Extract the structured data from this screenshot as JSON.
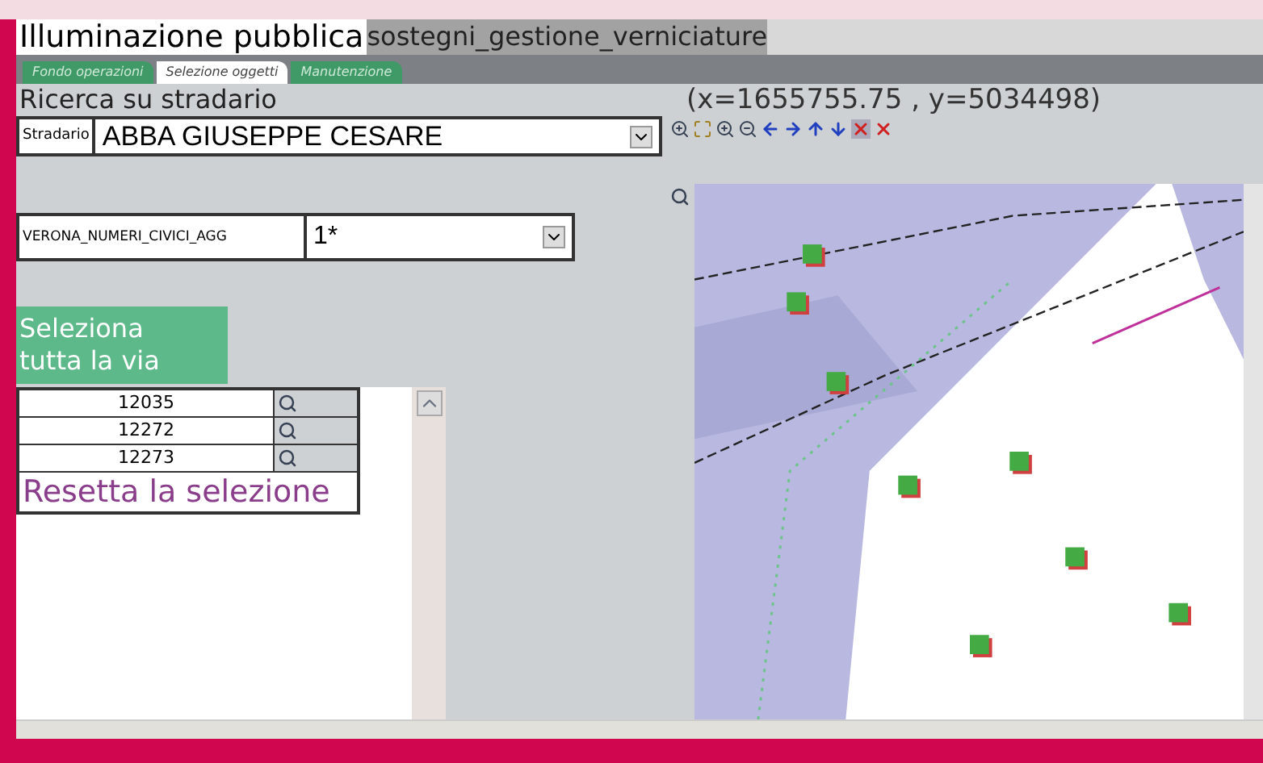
{
  "title": {
    "app": "Illuminazione pubblica",
    "layer": "sostegni_gestione_verniciature"
  },
  "tabs": [
    {
      "label": "Fondo operazioni",
      "selected": false
    },
    {
      "label": "Selezione oggetti",
      "selected": true
    },
    {
      "label": "Manutenzione",
      "selected": false
    }
  ],
  "search": {
    "heading": "Ricerca su stradario",
    "street_label": "Stradario",
    "street_value": "ABBA GIUSEPPE CESARE",
    "civic_label": "VERONA_NUMERI_CIVICI_AGG",
    "civic_value": "1*"
  },
  "select_all_button": "Seleziona tutta la via",
  "results": [
    {
      "id": "12035"
    },
    {
      "id": "12272"
    },
    {
      "id": "12273"
    }
  ],
  "reset_button": "Resetta la selezione",
  "coordinates": "(x=1655755.75 , y=5034498)"
}
